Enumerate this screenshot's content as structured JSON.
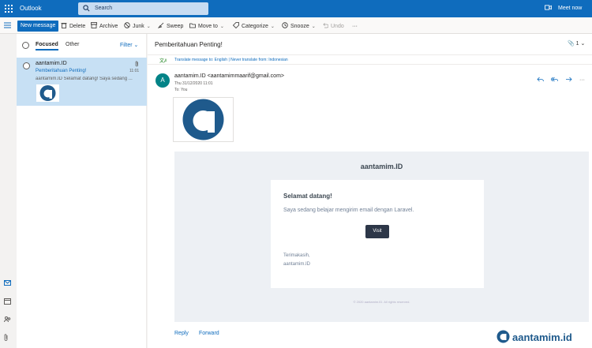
{
  "topbar": {
    "app_title": "Outlook",
    "search_placeholder": "Search",
    "meet_now": "Meet now"
  },
  "commands": {
    "new_message": "New message",
    "delete": "Delete",
    "archive": "Archive",
    "junk": "Junk",
    "sweep": "Sweep",
    "move_to": "Move to",
    "categorize": "Categorize",
    "snooze": "Snooze",
    "undo": "Undo",
    "more": "···"
  },
  "message_list": {
    "tab_focused": "Focused",
    "tab_other": "Other",
    "filter": "Filter",
    "items": [
      {
        "sender": "aantamim.ID",
        "subject": "Pemberitahuan Penting!",
        "time": "11:01",
        "preview": "aantamim.ID Selamat datang! Saya sedang ..."
      }
    ]
  },
  "reading_pane": {
    "subject": "Pemberitahuan Penting!",
    "attachment_count": "1",
    "translate_text": "Translate message to: English | Never translate from: Indonesian",
    "avatar_letter": "A",
    "from": "aantamim.ID <aantamimmaarif@gmail.com>",
    "date": "Thu 31/12/2020 11:01",
    "to": "To:  You",
    "reply": "Reply",
    "forward": "Forward"
  },
  "email": {
    "brand": "aantamim.ID",
    "heading": "Selamat datang!",
    "paragraph": "Saya sedang belajar mengirim email dengan Laravel.",
    "button": "Visit",
    "sign_1": "Terimakasih,",
    "sign_2": "aantamim.ID",
    "footer": "© 2020 aantamim.ID. All rights reserved."
  },
  "watermark": {
    "text": "aantamim.id"
  },
  "colors": {
    "brand_blue": "#0f6cbd",
    "selected_item": "#c7e0f4",
    "logo_blue": "#1f5a8c",
    "avatar": "#038387"
  }
}
